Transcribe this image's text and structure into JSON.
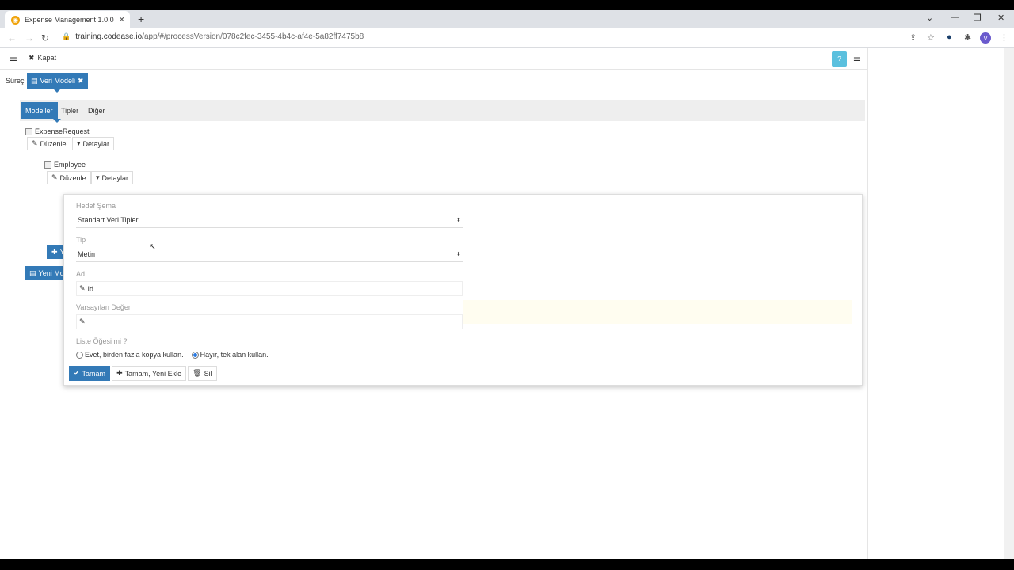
{
  "browser": {
    "tab_title": "Expense Management 1.0.0",
    "url_host": "training.codease.io",
    "url_path": "/app/#/processVersion/078c2fec-3455-4b4c-af4e-5a82ff7475b8",
    "avatar_letter": "V"
  },
  "header": {
    "close_label": "Kapat"
  },
  "breadcrumb": {
    "surec": "Süreç",
    "active": "Veri Modeli"
  },
  "subtabs": [
    "Modeller",
    "Tipler",
    "Diğer"
  ],
  "tree": {
    "root": "ExpenseRequest",
    "child": "Employee",
    "edit_label": "Düzenle",
    "details_label": "Detaylar",
    "add_partial": "Y",
    "new_model_partial": "Yeni Mo"
  },
  "form": {
    "target_schema_label": "Hedef Şema",
    "target_schema_value": "Standart Veri Tipleri",
    "type_label": "Tip",
    "type_value": "Metin",
    "name_label": "Ad",
    "name_value": "Id",
    "default_label": "Varsayılan Değer",
    "default_value": "",
    "list_label": "Liste Öğesi mi ?",
    "radio_yes": "Evet, birden fazla kopya kullan.",
    "radio_no": "Hayır, tek alan kullan.",
    "selected": "no",
    "ok_label": "Tamam",
    "ok_new_label": "Tamam, Yeni Ekle",
    "delete_label": "Sil"
  },
  "colors": {
    "primary": "#337ab7",
    "help": "#5bc0de"
  }
}
